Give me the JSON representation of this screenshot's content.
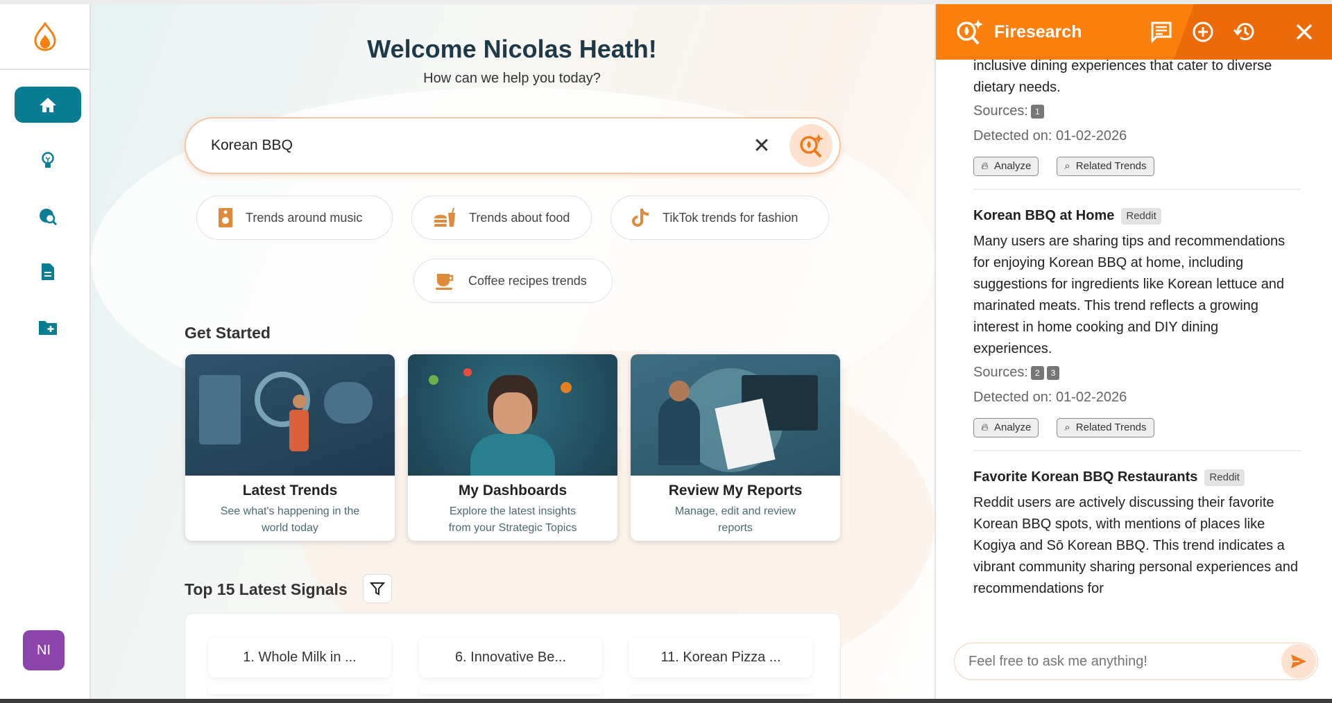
{
  "sidebar": {
    "items": [
      {
        "name": "home",
        "active": true
      },
      {
        "name": "ideas"
      },
      {
        "name": "global-search"
      },
      {
        "name": "reports"
      },
      {
        "name": "new-folder"
      }
    ],
    "avatar": "NI"
  },
  "main": {
    "title": "Welcome Nicolas Heath!",
    "subtitle": "How can we help you today?",
    "search_value": "Korean BBQ",
    "suggestions": [
      "Trends around music",
      "Trends about food",
      "TikTok trends for fashion",
      "Coffee recipes trends"
    ],
    "get_started": "Get Started",
    "cards": [
      {
        "title": "Latest Trends",
        "desc": "See what's happening in the world today"
      },
      {
        "title": "My Dashboards",
        "desc": "Explore the latest insights from your Strategic Topics"
      },
      {
        "title": "Review My Reports",
        "desc": "Manage, edit and review reports"
      }
    ],
    "signals_title": "Top 15 Latest Signals",
    "signals": [
      "1. Whole Milk in ...",
      "6. Innovative Be...",
      "11. Korean Pizza ..."
    ]
  },
  "panel": {
    "title": "Firesearch",
    "colors": {
      "accent": "#fb7f0c"
    },
    "lead_text": "inclusive dining experiences that cater to diverse dietary needs.",
    "sources_label": "Sources:",
    "detected_label": "Detected on:",
    "analyze": "Analyze",
    "related": "Related Trends",
    "lead_sources": [
      "1"
    ],
    "lead_date": "01-02-2026",
    "items": [
      {
        "title": "Korean BBQ at Home",
        "badge": "Reddit",
        "text": "Many users are sharing tips and recommendations for enjoying Korean BBQ at home, including suggestions for ingredients like Korean lettuce and marinated meats. This trend reflects a growing interest in home cooking and DIY dining experiences.",
        "sources": [
          "2",
          "3"
        ],
        "date": "01-02-2026"
      },
      {
        "title": "Favorite Korean BBQ Restaurants",
        "badge": "Reddit",
        "text": "Reddit users are actively discussing their favorite Korean BBQ spots, with mentions of places like Kogiya and Sō Korean BBQ. This trend indicates a vibrant community sharing personal experiences and recommendations for"
      }
    ],
    "input_placeholder": "Feel free to ask me anything!"
  }
}
